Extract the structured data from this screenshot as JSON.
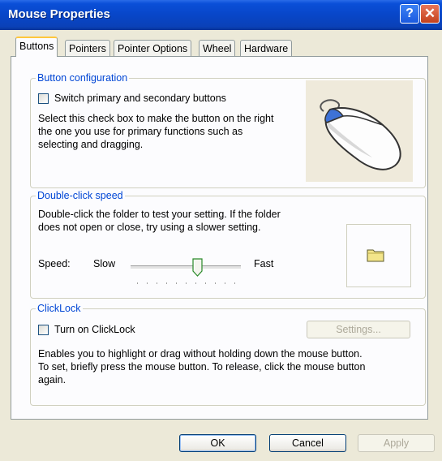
{
  "window": {
    "title": "Mouse Properties"
  },
  "titlebar": {
    "help_glyph": "?",
    "close_glyph": "✕"
  },
  "tabs": [
    {
      "label": "Buttons",
      "active": true
    },
    {
      "label": "Pointers"
    },
    {
      "label": "Pointer Options"
    },
    {
      "label": "Wheel"
    },
    {
      "label": "Hardware"
    }
  ],
  "button_config": {
    "legend": "Button configuration",
    "checkbox_label": "Switch primary and secondary buttons",
    "checked": false,
    "description_lines": [
      "Select this check box to make the button on the right",
      "the one you use for primary functions such as",
      "selecting and dragging."
    ]
  },
  "double_click": {
    "legend": "Double-click speed",
    "description_lines": [
      "Double-click the folder to test your setting. If the folder",
      "does not open or close, try using a slower setting."
    ],
    "speed_label": "Speed:",
    "slow_label": "Slow",
    "fast_label": "Fast",
    "slider_position": 0.6
  },
  "clicklock": {
    "legend": "ClickLock",
    "checkbox_label": "Turn on ClickLock",
    "checked": false,
    "settings_label": "Settings...",
    "description_lines": [
      "Enables you to highlight or drag without holding down the mouse button.",
      "To set, briefly press the mouse button. To release, click the mouse button",
      "again."
    ]
  },
  "footer": {
    "ok_label": "OK",
    "cancel_label": "Cancel",
    "apply_label": "Apply"
  },
  "colors": {
    "title_blue": "#0a4fd8",
    "group_label": "#0046d5",
    "folder": "#f3e58a"
  }
}
